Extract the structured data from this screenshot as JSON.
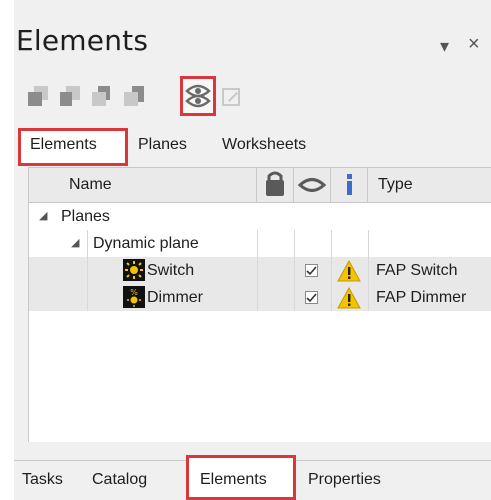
{
  "panel": {
    "title": "Elements",
    "pin_glyph": "▾",
    "close_glyph": "×"
  },
  "toolbar": {
    "buttons": [
      {
        "icon": "bring-to-front-icon"
      },
      {
        "icon": "bring-forward-icon"
      },
      {
        "icon": "send-backward-icon"
      },
      {
        "icon": "send-to-back-icon"
      },
      {
        "icon": "visibility-eye-icon",
        "highlighted": true
      },
      {
        "icon": "edit-icon"
      }
    ],
    "highlight_color": "#d9383a"
  },
  "top_tabs": {
    "items": [
      "Elements",
      "Planes",
      "Worksheets"
    ],
    "active": "Elements"
  },
  "grid": {
    "columns": {
      "name": "Name",
      "lock_icon": "lock-icon",
      "eye_icon": "eye-icon",
      "info_icon": "info-icon",
      "type": "Type"
    },
    "rows": [
      {
        "level": 0,
        "expander": "◢",
        "name": "Planes",
        "type": ""
      },
      {
        "level": 1,
        "expander": "◢",
        "name": "Dynamic plane",
        "type": ""
      },
      {
        "level": 2,
        "icon": "switch-icon",
        "name": "Switch",
        "visible": true,
        "warning": true,
        "type": "FAP Switch"
      },
      {
        "level": 2,
        "icon": "dimmer-icon",
        "name": "Dimmer",
        "visible": true,
        "warning": true,
        "type": "FAP Dimmer"
      }
    ]
  },
  "bottom_tabs": {
    "items": [
      "Tasks",
      "Catalog",
      "Elements",
      "Properties"
    ],
    "active": "Elements"
  }
}
